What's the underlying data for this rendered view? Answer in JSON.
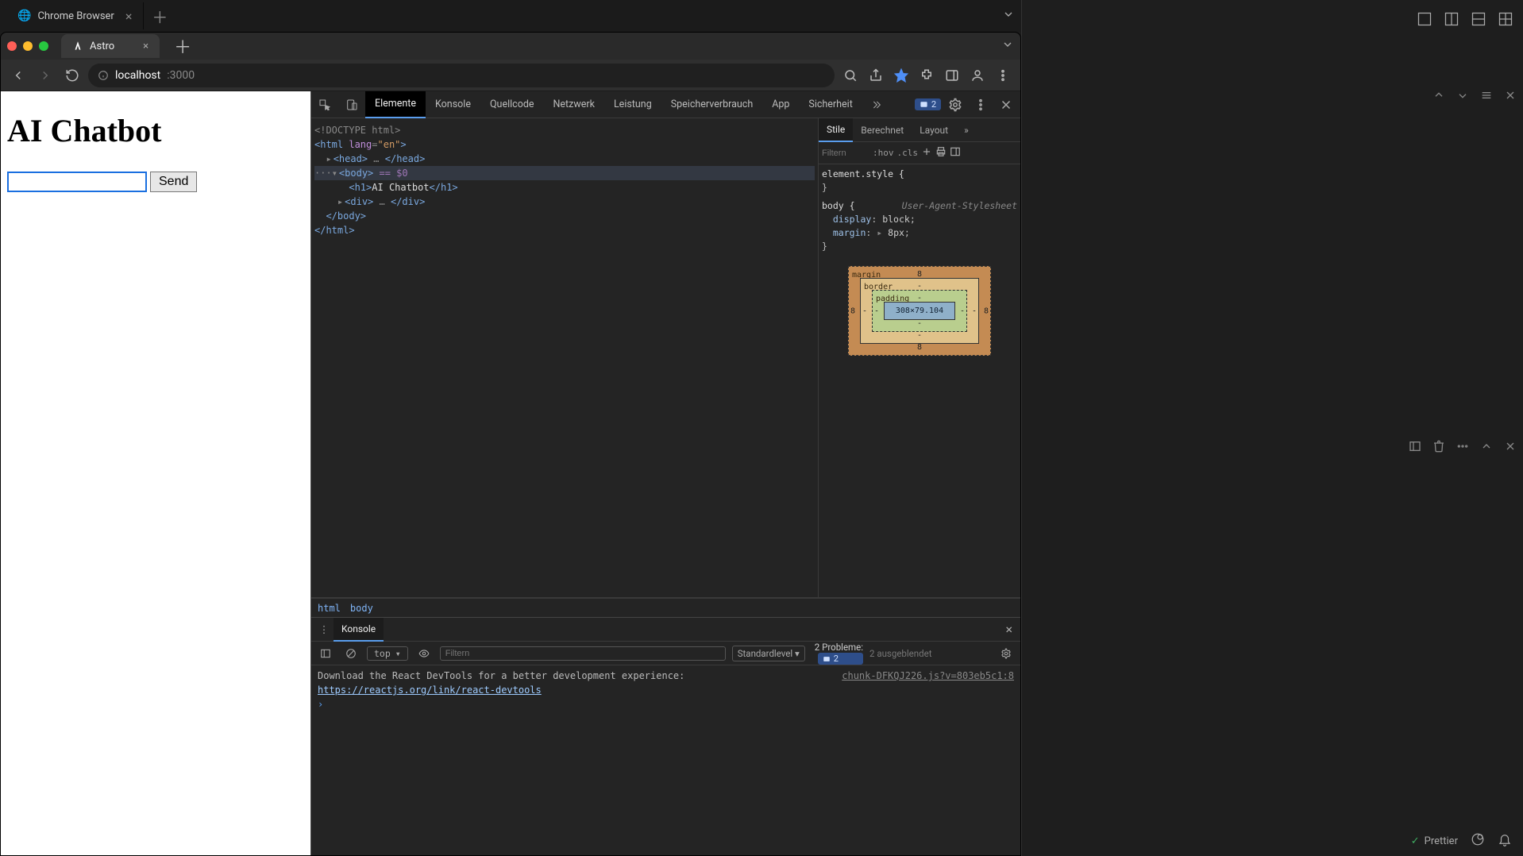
{
  "outerTab": {
    "label": "Chrome Browser"
  },
  "browser": {
    "tab": {
      "label": "Astro"
    },
    "url_domain": "localhost",
    "url_path": ":3000"
  },
  "page": {
    "heading": "AI Chatbot",
    "send_label": "Send"
  },
  "devtools": {
    "tabs": {
      "elements": "Elemente",
      "console": "Konsole",
      "sources": "Quellcode",
      "network": "Netzwerk",
      "performance": "Leistung",
      "memory": "Speicherverbrauch",
      "application": "App",
      "security": "Sicherheit"
    },
    "issue_count": "2",
    "dom": {
      "l1": "<!DOCTYPE html>",
      "l2_open": "<html ",
      "l2_attr": "lang",
      "l2_val": "\"en\"",
      "l2_close": ">",
      "l3": "<head>",
      "l3_ell": "…",
      "l3_end": "</head>",
      "l4": "<body>",
      "l4_eq": " == $0",
      "l5_open": "<h1>",
      "l5_text": "AI Chatbot",
      "l5_close": "</h1>",
      "l6": "<div>",
      "l6_ell": "…",
      "l6_end": "</div>",
      "l7": "</body>",
      "l8": "</html>"
    },
    "breadcrumb": {
      "a": "html",
      "b": "body"
    },
    "styles": {
      "tabs": {
        "styles": "Stile",
        "computed": "Berechnet",
        "layout": "Layout"
      },
      "filter_ph": "Filtern",
      "hov": ":hov",
      "cls": ".cls",
      "elstyle": "element.style {",
      "bodysel": "body {",
      "ualabel": "User-Agent-Stylesheet",
      "p_display": "display",
      "v_display": "block",
      "p_margin": "margin",
      "v_margin": "8px",
      "brace_close": "}"
    },
    "boxmodel": {
      "margin_label": "margin",
      "border_label": "border",
      "padding_label": "padding",
      "margin": "8",
      "border": "-",
      "padding": "-",
      "content": "308×79.104"
    }
  },
  "drawer": {
    "tab": "Konsole",
    "context": "top",
    "filter_ph": "Filtern",
    "level": "Standardlevel",
    "problems_label": "2 Probleme:",
    "problems_count": "2",
    "hidden": "2 ausgeblendet",
    "src": "chunk-DFKQJ226.js?v=803eb5c1:8",
    "msg_pre": "Download the React DevTools for a better development experience: ",
    "msg_link": "https://reactjs.org/link/react-devtools"
  },
  "statusbar": {
    "prettier": "Prettier"
  }
}
